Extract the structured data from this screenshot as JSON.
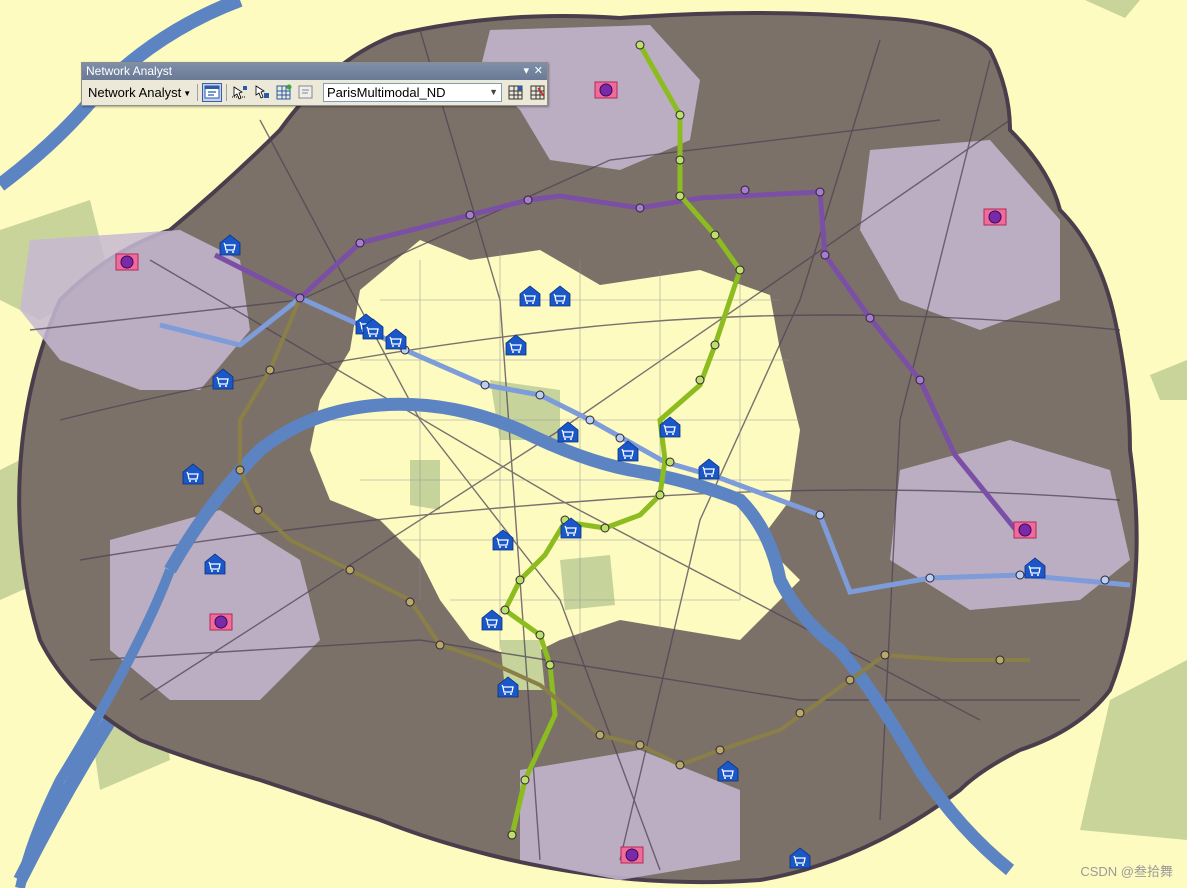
{
  "toolbar": {
    "title": "Network Analyst",
    "menu_label": "Network Analyst",
    "dataset_value": "ParisMultimodal_ND",
    "pin_glyph": "▾",
    "close_glyph": "✕",
    "tools": [
      "network-analyst-window-icon",
      "create-network-location-icon",
      "select-move-location-icon",
      "solve-icon",
      "build-directions-icon",
      "build-network-icon",
      "network-identify-icon"
    ]
  },
  "map": {
    "colors": {
      "background": "#fdfbc0",
      "city_fill": "#7b7168",
      "inner_light": "#fdfbc0",
      "service_area": "#c7b8d2",
      "river": "#5d84c2",
      "park": "#c6d49c",
      "line_purple": "#7b4fa5",
      "line_green": "#8cbc1f",
      "line_blue": "#7d9cd9",
      "line_olive": "#8a7f46",
      "store_icon": "#1a57c9",
      "facility_icon": "#e8528a"
    },
    "facility_count": 6,
    "store_count": 20
  },
  "footer": {
    "watermark": "CSDN @叁拾舞"
  }
}
